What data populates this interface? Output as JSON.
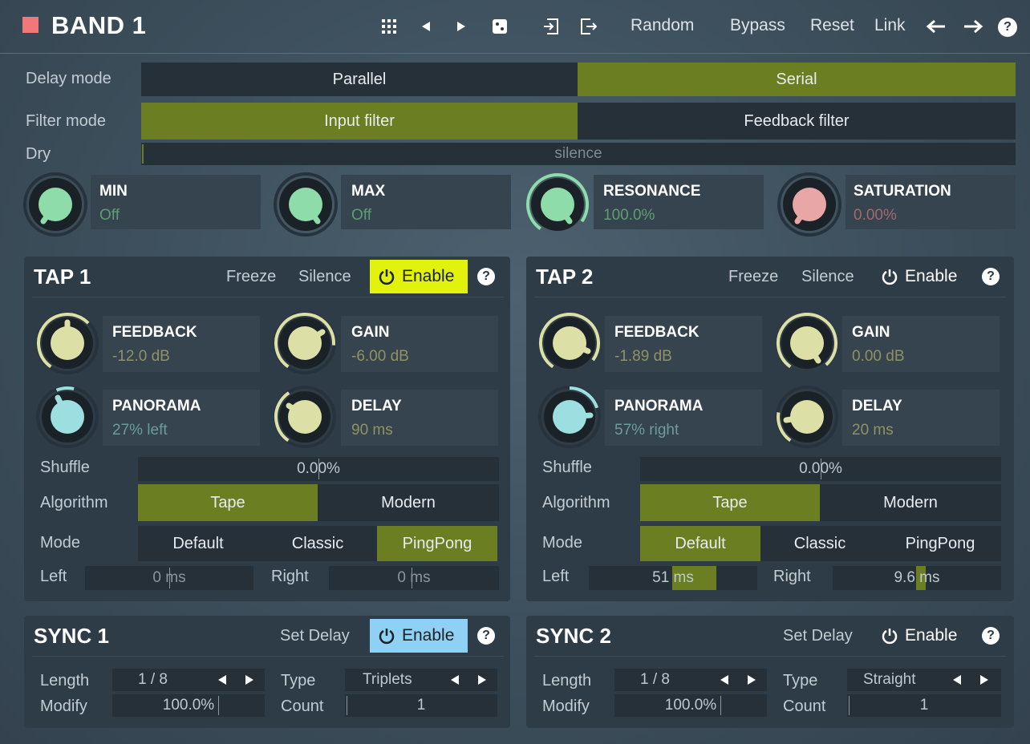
{
  "header": {
    "title": "BAND 1",
    "random": "Random",
    "bypass": "Bypass",
    "reset": "Reset",
    "link": "Link",
    "help": "?",
    "brand_color": "#f07878"
  },
  "delay_mode": {
    "label": "Delay mode",
    "options": [
      "Parallel",
      "Serial"
    ],
    "selected": "Serial"
  },
  "filter_mode": {
    "label": "Filter mode",
    "options": [
      "Input filter",
      "Feedback filter"
    ],
    "selected": "Input filter"
  },
  "dry": {
    "label": "Dry",
    "value": "silence"
  },
  "knobs": {
    "min": {
      "title": "MIN",
      "value": "Off",
      "level": 0.0
    },
    "max": {
      "title": "MAX",
      "value": "Off",
      "level": 0.0
    },
    "resonance": {
      "title": "RESONANCE",
      "value": "100.0%",
      "level": 1.0
    },
    "saturation": {
      "title": "SATURATION",
      "value": "0.00%",
      "level": 0.0
    }
  },
  "tap1": {
    "title": "TAP 1",
    "freeze": "Freeze",
    "silence": "Silence",
    "enable": "Enable",
    "help": "?",
    "feedback": {
      "title": "FEEDBACK",
      "value": "-12.0 dB"
    },
    "gain": {
      "title": "GAIN",
      "value": "-6.00 dB"
    },
    "panorama": {
      "title": "PANORAMA",
      "value": "27% left"
    },
    "delay": {
      "title": "DELAY",
      "value": "90 ms"
    },
    "shuffle": {
      "label": "Shuffle",
      "value": "0.00%"
    },
    "algorithm": {
      "label": "Algorithm",
      "options": [
        "Tape",
        "Modern"
      ],
      "selected": "Tape"
    },
    "mode": {
      "label": "Mode",
      "options": [
        "Default",
        "Classic",
        "PingPong"
      ],
      "selected": "PingPong"
    },
    "left": {
      "label": "Left",
      "value": "0 ms"
    },
    "right": {
      "label": "Right",
      "value": "0 ms"
    }
  },
  "tap2": {
    "title": "TAP 2",
    "freeze": "Freeze",
    "silence": "Silence",
    "enable": "Enable",
    "help": "?",
    "feedback": {
      "title": "FEEDBACK",
      "value": "-1.89 dB"
    },
    "gain": {
      "title": "GAIN",
      "value": "0.00 dB"
    },
    "panorama": {
      "title": "PANORAMA",
      "value": "57% right"
    },
    "delay": {
      "title": "DELAY",
      "value": "20 ms"
    },
    "shuffle": {
      "label": "Shuffle",
      "value": "0.00%"
    },
    "algorithm": {
      "label": "Algorithm",
      "options": [
        "Tape",
        "Modern"
      ],
      "selected": "Tape"
    },
    "mode": {
      "label": "Mode",
      "options": [
        "Default",
        "Classic",
        "PingPong"
      ],
      "selected": "Default"
    },
    "left": {
      "label": "Left",
      "value": "51 ms"
    },
    "right": {
      "label": "Right",
      "value": "9.6 ms"
    }
  },
  "sync1": {
    "title": "SYNC 1",
    "set_delay": "Set Delay",
    "enable": "Enable",
    "help": "?",
    "length": {
      "label": "Length",
      "value": "1 / 8"
    },
    "type": {
      "label": "Type",
      "value": "Triplets"
    },
    "modify": {
      "label": "Modify",
      "value": "100.0%"
    },
    "count": {
      "label": "Count",
      "value": "1"
    }
  },
  "sync2": {
    "title": "SYNC 2",
    "set_delay": "Set Delay",
    "enable": "Enable",
    "help": "?",
    "length": {
      "label": "Length",
      "value": "1 / 8"
    },
    "type": {
      "label": "Type",
      "value": "Straight"
    },
    "modify": {
      "label": "Modify",
      "value": "100.0%"
    },
    "count": {
      "label": "Count",
      "value": "1"
    }
  },
  "colors": {
    "selected_segment": "#6b7e21",
    "enable_active_yellow": "#e3f20c",
    "enable_active_blue": "#8fd0f5",
    "knob_green": "#8edcaa",
    "knob_yellow": "#dde0a6",
    "knob_cyan": "#9ddfe0",
    "knob_pink": "#e8a6a6"
  }
}
